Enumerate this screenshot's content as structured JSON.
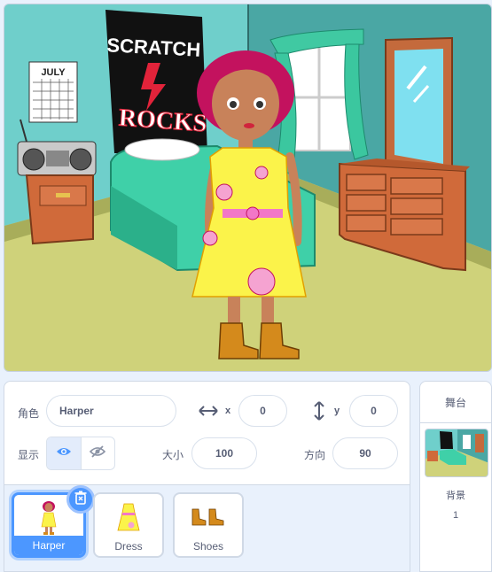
{
  "stage": {
    "backdrop": "bedroom",
    "sprite": "Harper",
    "poster": {
      "line1": "SCRATCH",
      "line2": "ROCKS"
    },
    "calendar": {
      "month": "JULY"
    }
  },
  "sprite_info": {
    "sprite_label": "角色",
    "sprite_name": "Harper",
    "x_label": "x",
    "x_value": "0",
    "y_label": "y",
    "y_value": "0",
    "show_label": "显示",
    "size_label": "大小",
    "size_value": "100",
    "direction_label": "方向",
    "direction_value": "90",
    "visible": true
  },
  "sprites": [
    {
      "name": "Harper",
      "selected": true
    },
    {
      "name": "Dress",
      "selected": false
    },
    {
      "name": "Shoes",
      "selected": false
    }
  ],
  "stage_pane": {
    "title": "舞台",
    "backdrops_label": "背景",
    "backdrops_count": "1"
  },
  "colors": {
    "accent": "#4c97ff",
    "text": "#575e75",
    "panel_bg": "#e9f1fc"
  }
}
